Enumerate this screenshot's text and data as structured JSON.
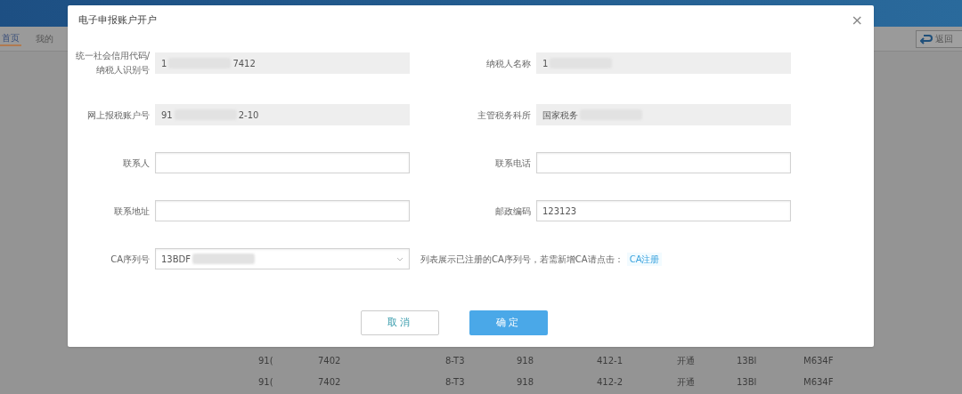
{
  "background": {
    "nav_tabs": [
      {
        "label": "首页",
        "selected": true
      },
      {
        "label": "我的",
        "selected": false
      }
    ],
    "back_button": "返回",
    "table_rows": [
      [
        "91(",
        "7402",
        "8-T3",
        "918",
        "412-1",
        "开通",
        "13Bl",
        "M634F"
      ],
      [
        "91(",
        "7402",
        "8-T3",
        "918",
        "412-2",
        "开通",
        "13Bl",
        "M634F"
      ]
    ]
  },
  "dialog": {
    "title": "电子申报账户开户",
    "close": "×",
    "fields": [
      {
        "label": "统一社会信用代码/纳税人识别号",
        "prefix": "1",
        "suffix": "7412",
        "redacted": true,
        "readonly": true,
        "kind": "input"
      },
      {
        "label": "纳税人名称",
        "prefix": "1",
        "redacted": true,
        "readonly": true,
        "kind": "input"
      },
      {
        "label": "网上报税账户号",
        "prefix": "91",
        "suffix": "2-10",
        "redacted": true,
        "readonly": true,
        "kind": "input"
      },
      {
        "label": "主管税务科所",
        "prefix": "国家税务",
        "redacted": true,
        "readonly": true,
        "kind": "input"
      },
      {
        "label": "联系人",
        "readonly": false,
        "kind": "input"
      },
      {
        "label": "联系电话",
        "readonly": false,
        "kind": "input"
      },
      {
        "label": "联系地址",
        "readonly": false,
        "kind": "input"
      },
      {
        "label": "邮政编码",
        "prefix": "123123",
        "readonly": false,
        "kind": "input"
      },
      {
        "label": "CA序列号",
        "prefix": "13BDF",
        "redacted": true,
        "readonly": false,
        "kind": "select"
      }
    ],
    "hint": "列表展示已注册的CA序列号，若需新增CA请点击：",
    "hint_link": "CA注册",
    "buttons": [
      {
        "label": "取消",
        "kind": "secondary"
      },
      {
        "label": "确定",
        "kind": "primary"
      }
    ]
  }
}
